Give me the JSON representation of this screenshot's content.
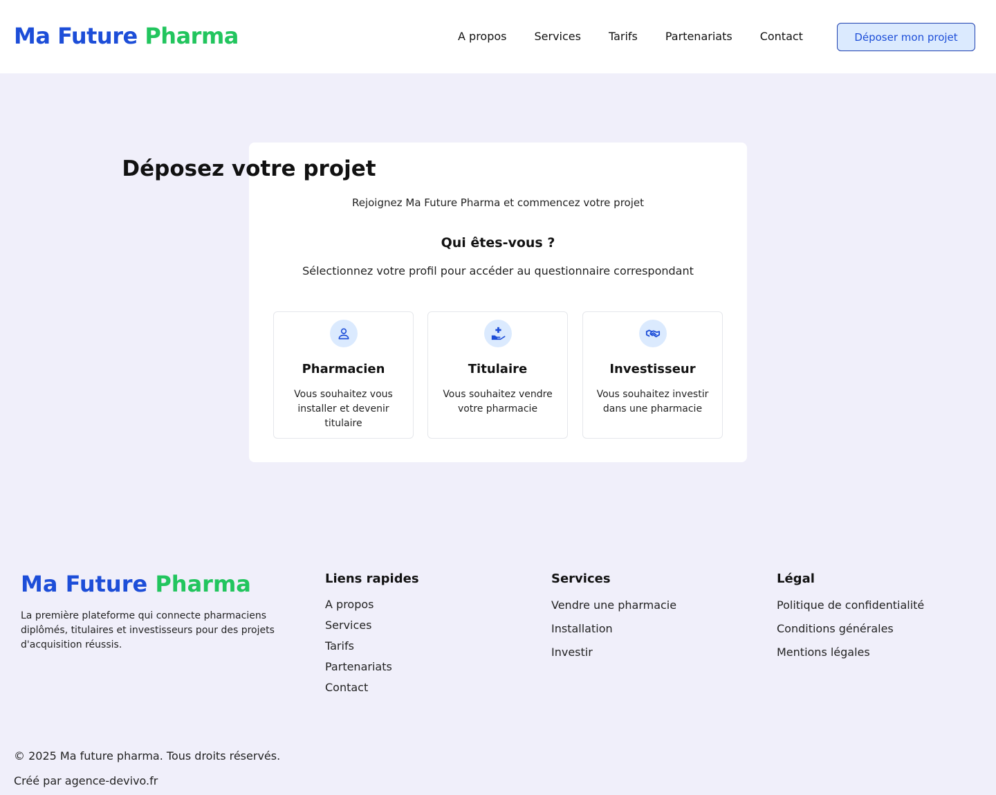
{
  "brand": {
    "part1": "Ma Future",
    "part2": "Pharma",
    "color1": "#1d4ed8",
    "color2": "#22c55e"
  },
  "nav": {
    "items": [
      {
        "label": "A propos"
      },
      {
        "label": "Services"
      },
      {
        "label": "Tarifs"
      },
      {
        "label": "Partenariats"
      },
      {
        "label": "Contact"
      }
    ],
    "cta_label": "Déposer mon projet"
  },
  "main": {
    "title": "Déposez votre projet",
    "subtitle": "Rejoignez Ma Future Pharma et commencez votre projet",
    "question": "Qui êtes-vous ?",
    "help": "Sélectionnez votre profil pour accéder au questionnaire correspondant",
    "profiles": [
      {
        "icon": "user-icon",
        "title": "Pharmacien",
        "desc": "Vous souhaitez vous installer et devenir titulaire"
      },
      {
        "icon": "hand-plus-icon",
        "title": "Titulaire",
        "desc": "Vous souhaitez vendre votre pharmacie"
      },
      {
        "icon": "handshake-icon",
        "title": "Investisseur",
        "desc": "Vous souhaitez investir dans une pharmacie"
      }
    ]
  },
  "footer": {
    "description": "La première plateforme qui connecte pharmaciens diplômés, titulaires et investisseurs pour des projets d'acquisition réussis.",
    "quick_links": {
      "title": "Liens rapides",
      "items": [
        "A propos",
        "Services",
        "Tarifs",
        "Partenariats",
        "Contact"
      ]
    },
    "services": {
      "title": "Services",
      "items": [
        "Vendre une pharmacie",
        "Installation",
        "Investir"
      ]
    },
    "legal": {
      "title": "Légal",
      "items": [
        "Politique de confidentialité",
        "Conditions générales",
        "Mentions légales"
      ]
    },
    "copyright": "© 2025 Ma future pharma. Tous droits réservés.",
    "credit": "Créé par agence-devivo.fr"
  }
}
